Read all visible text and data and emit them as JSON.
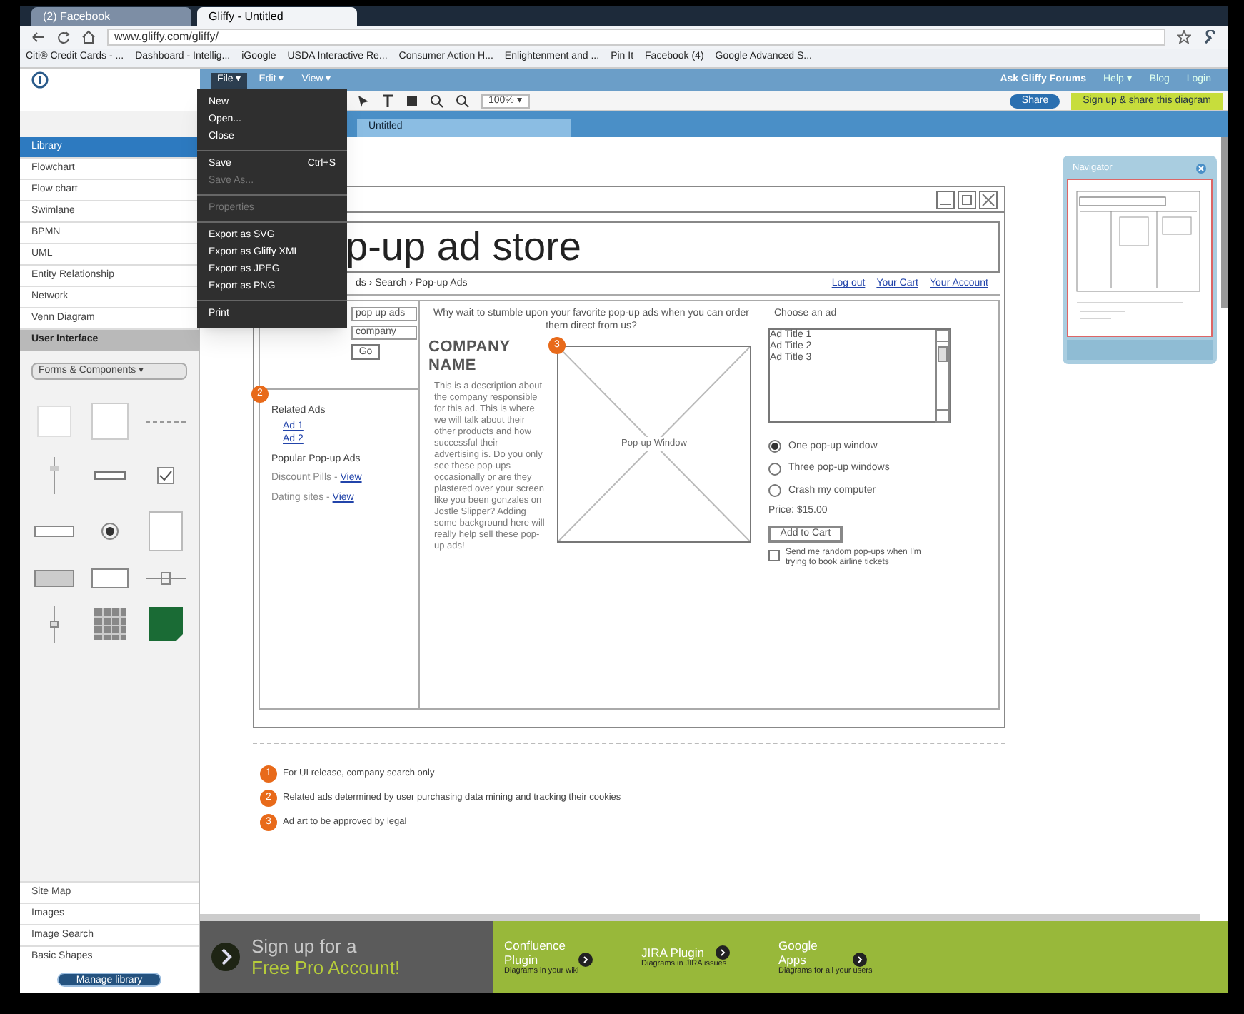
{
  "browser": {
    "tabs": [
      {
        "label": "(2) Facebook",
        "selected": false
      },
      {
        "label": "Gliffy - Untitled",
        "selected": true
      }
    ],
    "url": "www.gliffy.com/gliffy/",
    "bookmarks": [
      "Citi® Credit Cards - ...",
      "Dashboard - Intellig...",
      "iGoogle",
      "USDA Interactive Re...",
      "Consumer Action H...",
      "Enlightenment and ...",
      "Pin It",
      "Facebook (4)",
      "Google Advanced S..."
    ]
  },
  "app": {
    "menus": [
      {
        "label": "File ▾",
        "selected": true
      },
      {
        "label": "Edit ▾",
        "selected": false
      },
      {
        "label": "View ▾",
        "selected": false
      }
    ],
    "header_links": [
      "Ask Gliffy Forums",
      "Help ▾",
      "Blog",
      "Login"
    ],
    "zoom": "100% ▾",
    "share_button": "Share",
    "signup_button": "Sign up & share this diagram",
    "document_tab": "Untitled"
  },
  "file_menu": [
    {
      "kind": "item",
      "label": "New",
      "disabled": false
    },
    {
      "kind": "item",
      "label": "Open...",
      "disabled": false
    },
    {
      "kind": "item",
      "label": "Close",
      "disabled": false
    },
    {
      "kind": "separator"
    },
    {
      "kind": "item",
      "label": "Save",
      "shortcut": "Ctrl+S",
      "disabled": false
    },
    {
      "kind": "item",
      "label": "Save As...",
      "disabled": true
    },
    {
      "kind": "separator"
    },
    {
      "kind": "item",
      "label": "Properties",
      "disabled": true
    },
    {
      "kind": "separator"
    },
    {
      "kind": "item",
      "label": "Export as SVG",
      "disabled": false
    },
    {
      "kind": "item",
      "label": "Export as Gliffy XML",
      "disabled": false
    },
    {
      "kind": "item",
      "label": "Export as JPEG",
      "disabled": false
    },
    {
      "kind": "item",
      "label": "Export as PNG",
      "disabled": false
    },
    {
      "kind": "separator"
    },
    {
      "kind": "item",
      "label": "Print",
      "disabled": false
    }
  ],
  "sidebar": {
    "items": [
      {
        "label": "Library",
        "selected": true
      },
      {
        "label": "Flowchart",
        "selected": false
      },
      {
        "label": "Flow chart",
        "selected": false
      },
      {
        "label": "Swimlane",
        "selected": false
      },
      {
        "label": "BPMN",
        "selected": false
      },
      {
        "label": "UML",
        "selected": false
      },
      {
        "label": "Entity Relationship",
        "selected": false
      },
      {
        "label": "Network",
        "selected": false
      },
      {
        "label": "Venn Diagram",
        "selected": false
      }
    ],
    "section": "User Interface",
    "dropdown": "Forms & Components ▾",
    "bottom_items": [
      "Site Map",
      "Images",
      "Image Search",
      "Basic Shapes"
    ],
    "manage_button": "Manage library"
  },
  "wireframe": {
    "title": "p-up ad store",
    "breadcrumb": "ds › Search › Pop-up Ads",
    "nav_links": [
      "Log out",
      "Your Cart",
      "Your Account"
    ],
    "search_value": "pop up ads",
    "company_value": "company",
    "go_button": "Go",
    "related_title": "Related Ads",
    "related_links": [
      "Ad 1",
      "Ad 2"
    ],
    "popular_title": "Popular Pop-up Ads",
    "popular": [
      {
        "text": "Discount Pills - ",
        "link": "View"
      },
      {
        "text": "Dating sites - ",
        "link": "View"
      }
    ],
    "tagline": "Why wait to stumble upon your favorite pop-up ads when you can order them direct from us?",
    "company": "COMPANY NAME",
    "description": "This is a description about the company responsible for this ad. This is where we will talk about their other products and how successful their advertising is. Do you only see these pop-ups occasionally or are they plastered over your screen like you been gonzales on Jostle Slipper? Adding some background here will really help sell these pop-up ads!",
    "image_label": "Pop-up Window",
    "choose_label": "Choose an ad",
    "ad_titles": [
      "Ad Title 1",
      "Ad Title 2",
      "Ad Title 3"
    ],
    "options": [
      {
        "label": "One pop-up window",
        "selected": true
      },
      {
        "label": "Three pop-up windows",
        "selected": false
      },
      {
        "label": "Crash my computer",
        "selected": false
      }
    ],
    "price": "Price: $15.00",
    "add_button": "Add to Cart",
    "checkbox": {
      "label": "Send me random pop-ups when I'm trying to book airline tickets",
      "checked": false
    },
    "markers": {
      "related": "2",
      "image": "3"
    }
  },
  "notes": [
    {
      "number": "1",
      "text": "For UI release, company search only"
    },
    {
      "number": "2",
      "text": "Related ads determined by user purchasing data mining and tracking their cookies"
    },
    {
      "number": "3",
      "text": "Ad art to be approved by legal"
    }
  ],
  "navigator": {
    "title": "Navigator"
  },
  "banner": {
    "signup": [
      "Sign up for a",
      "Free Pro Account!"
    ],
    "plugins": [
      {
        "title": "Confluence Plugin",
        "subtitle": "Diagrams in your wiki"
      },
      {
        "title": "JIRA Plugin",
        "subtitle": "Diagrams in JIRA issues"
      },
      {
        "title": "Google Apps",
        "subtitle": "Diagrams for all your users"
      }
    ]
  }
}
